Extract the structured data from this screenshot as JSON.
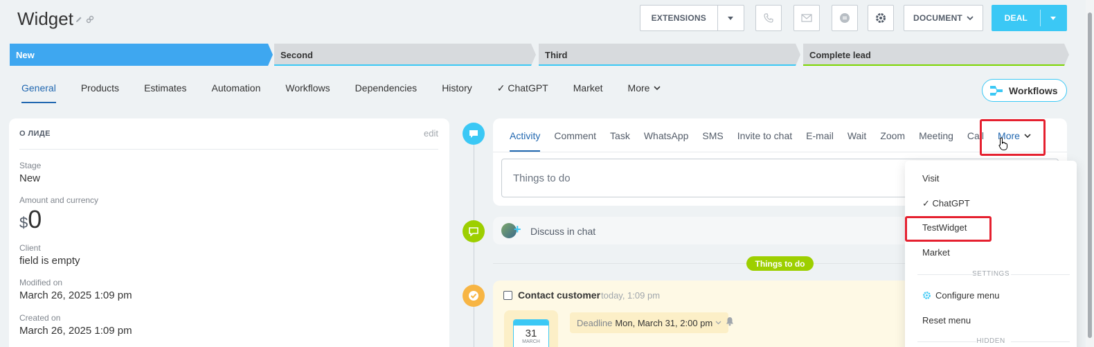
{
  "header": {
    "title": "Widget",
    "extensions_label": "EXTENSIONS",
    "document_label": "DOCUMENT",
    "deal_label": "DEAL"
  },
  "stages": [
    {
      "label": "New",
      "color": "#3ea7f0",
      "underline": "#3ea7f0"
    },
    {
      "label": "Second",
      "color": "#d7dadd",
      "underline": "#3bc8f5"
    },
    {
      "label": "Third",
      "color": "#d7dadd",
      "underline": "#3bc8f5"
    },
    {
      "label": "Complete lead",
      "color": "#d7dadd",
      "underline": "#7bd500"
    }
  ],
  "tabs": [
    "General",
    "Products",
    "Estimates",
    "Automation",
    "Workflows",
    "Dependencies",
    "History",
    "✓ ChatGPT",
    "Market",
    "More"
  ],
  "workflows_button": "Workflows",
  "about": {
    "heading": "О ЛИДЕ",
    "edit": "edit",
    "fields": [
      {
        "label": "Stage",
        "value": "New"
      },
      {
        "label": "Amount and currency",
        "currency": "$",
        "value": "0"
      },
      {
        "label": "Client",
        "value": "field is empty"
      },
      {
        "label": "Modified on",
        "value": "March 26, 2025 1:09 pm"
      },
      {
        "label": "Created on",
        "value": "March 26, 2025 1:09 pm"
      }
    ]
  },
  "activity": {
    "tabs": [
      "Activity",
      "Comment",
      "Task",
      "WhatsApp",
      "SMS",
      "Invite to chat",
      "E-mail",
      "Wait",
      "Zoom",
      "Meeting",
      "Call",
      "More"
    ],
    "placeholder": "Things to do"
  },
  "chat": {
    "text": "Discuss in chat"
  },
  "todo_badge": "Things to do",
  "task": {
    "title": "Contact customer",
    "time": "today, 1:09 pm",
    "calendar_day": "31",
    "calendar_month": "MARCH",
    "deadline_label": "Deadline",
    "deadline_value": "Mon, March 31, 2:00 pm"
  },
  "more_menu": {
    "items": [
      "Visit",
      "✓ ChatGPT",
      "TestWidget",
      "Market"
    ],
    "settings_heading": "SETTINGS",
    "configure": "Configure menu",
    "reset": "Reset menu",
    "hidden_heading": "HIDDEN"
  },
  "colors": {
    "accent": "#3bc8f5",
    "link": "#2067b0",
    "highlight": "#e5202f",
    "green": "#9dcf00",
    "yellow": "#f7b544"
  }
}
